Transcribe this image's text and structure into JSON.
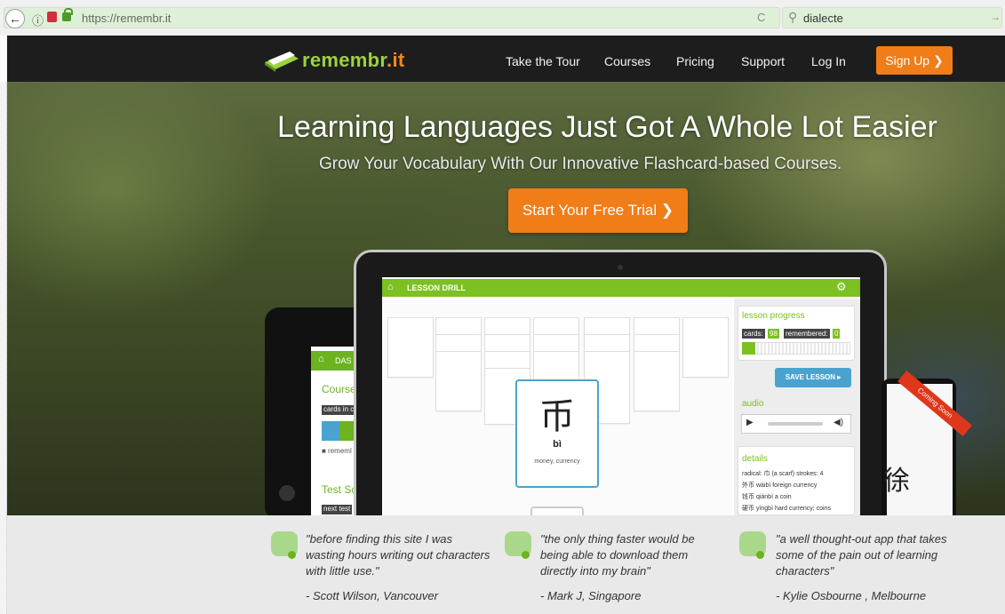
{
  "browser": {
    "url": "https://remembr.it",
    "search_value": "dialecte",
    "back_glyph": "←",
    "info_glyph": "ⓘ",
    "reload_glyph": "C",
    "search_glyph": "⚲",
    "go_glyph": "→"
  },
  "nav": {
    "logo_main": "remembr",
    "logo_suffix": ".it",
    "links": [
      "Take the Tour",
      "Courses",
      "Pricing",
      "Support",
      "Log In"
    ],
    "signup": "Sign Up ❯"
  },
  "hero": {
    "title": "Learning Languages Just Got A Whole Lot Easier",
    "subtitle": "Grow Your Vocabulary With Our Innovative Flashcard-based Courses.",
    "cta": "Start Your Free Trial ❯"
  },
  "app_preview": {
    "tablet": {
      "header": "DAS",
      "course": "Course",
      "cards_tag": "cards in c",
      "legend": "■ rememl",
      "test": "Test Sc",
      "next_tag": "next test"
    },
    "drill_header": "LESSON DRILL",
    "card_char": "币",
    "card_pinyin": "bì",
    "card_meaning": "money, currency",
    "lesson_progress": "lesson progress",
    "cards_label": "cards:",
    "cards_count": "98",
    "remembered_label": "remembered:",
    "remembered_count": "0",
    "progress_fraction": 0.12,
    "save_lesson": "SAVE LESSON ▸",
    "audio_label": "audio",
    "details_label": "details",
    "details_lines": [
      "radical: 巾 (a scarf)   strokes: 4",
      "外币  wàibì  foreign currency",
      "钱币  qiánbì  a coin",
      "硬币  yìngbì  hard currency; coins"
    ],
    "coming_soon": "Coming Soon",
    "phone_char": "徐"
  },
  "testimonials": [
    {
      "quote": "\"before finding this site I was wasting hours writing out characters with little use.\"",
      "author": "- Scott Wilson, Vancouver"
    },
    {
      "quote": "\"the only thing faster would be being able to download them directly into my brain\"",
      "author": "- Mark J, Singapore"
    },
    {
      "quote": "\"a well thought-out app that takes some of the pain out of learning characters\"",
      "author": "- Kylie Osbourne , Melbourne"
    }
  ],
  "colors": {
    "brand_green": "#7cc021",
    "brand_orange": "#f07d18",
    "nav_bg": "#1d1d1d",
    "accent_blue": "#4aa3cf"
  }
}
